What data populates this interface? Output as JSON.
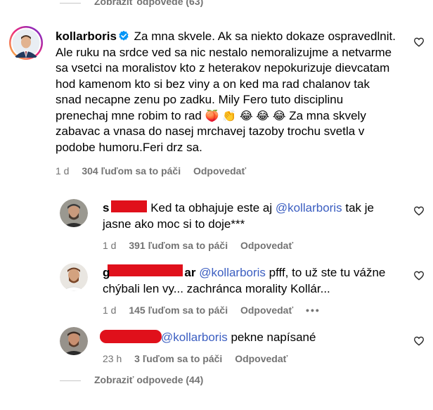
{
  "top_divider": {
    "view_replies": "Zobraziť odpovede (63)"
  },
  "main_comment": {
    "username": "kollarboris",
    "lines": [
      "Za mna skvele. Ak sa niekto dokaze ospravedlnit.",
      "Ale ruku na srdce ved sa nic nestalo nemoralizujme a netvarme",
      "sa vsetci na moralistov kto z heterakov nepokurizuje dievcatam",
      "hod kamenom kto si bez viny a on ked ma rad chalanov tak",
      "snad necapne zenu po zadku. Mily Fero tuto disciplinu",
      "prenechaj mne robim to rad",
      "Za mna skvely",
      "zabavac a vnasa do nasej mrchavej tazoby trochu svetla v",
      "podobe humoru.Feri drz sa."
    ],
    "emojis": [
      "🍑",
      "👏",
      "😂",
      "😂",
      "😂"
    ],
    "time": "1 d",
    "likes": "304 ľuďom sa to páči",
    "reply": "Odpovedať"
  },
  "replies": [
    {
      "prefix": "s",
      "text_line1": " Ked ta obhajuje este aj ",
      "mention": "@kollarboris",
      "text_line1_end": " tak je",
      "text_line2": "jasne ako moc si to doje***",
      "time": "1 d",
      "likes": "391 ľuďom sa to páči",
      "reply": "Odpovedať"
    },
    {
      "prefix": "g",
      "suffix": "ar",
      "mention": "@kollarboris",
      "text_line1_end": " pfff, to už ste tu vážne",
      "text_line2": "chýbali len vy... zachránca morality Kollár...",
      "time": "1 d",
      "likes": "145 ľuďom sa to páči",
      "reply": "Odpovedať",
      "more": "•••"
    },
    {
      "mention": "@kollarboris",
      "text_line1_end": " pekne napísané",
      "time": "23 h",
      "likes": "3 ľuďom sa to páči",
      "reply": "Odpovedať"
    }
  ],
  "bottom_divider": {
    "view_replies": "Zobraziť odpovede (44)"
  },
  "colors": {
    "mention": "#3b5ec1",
    "meta": "#737373",
    "redaction": "#e0101b",
    "verified": "#0095f6"
  },
  "icons": [
    "heart-icon",
    "verified-badge-icon",
    "more-options-icon"
  ]
}
